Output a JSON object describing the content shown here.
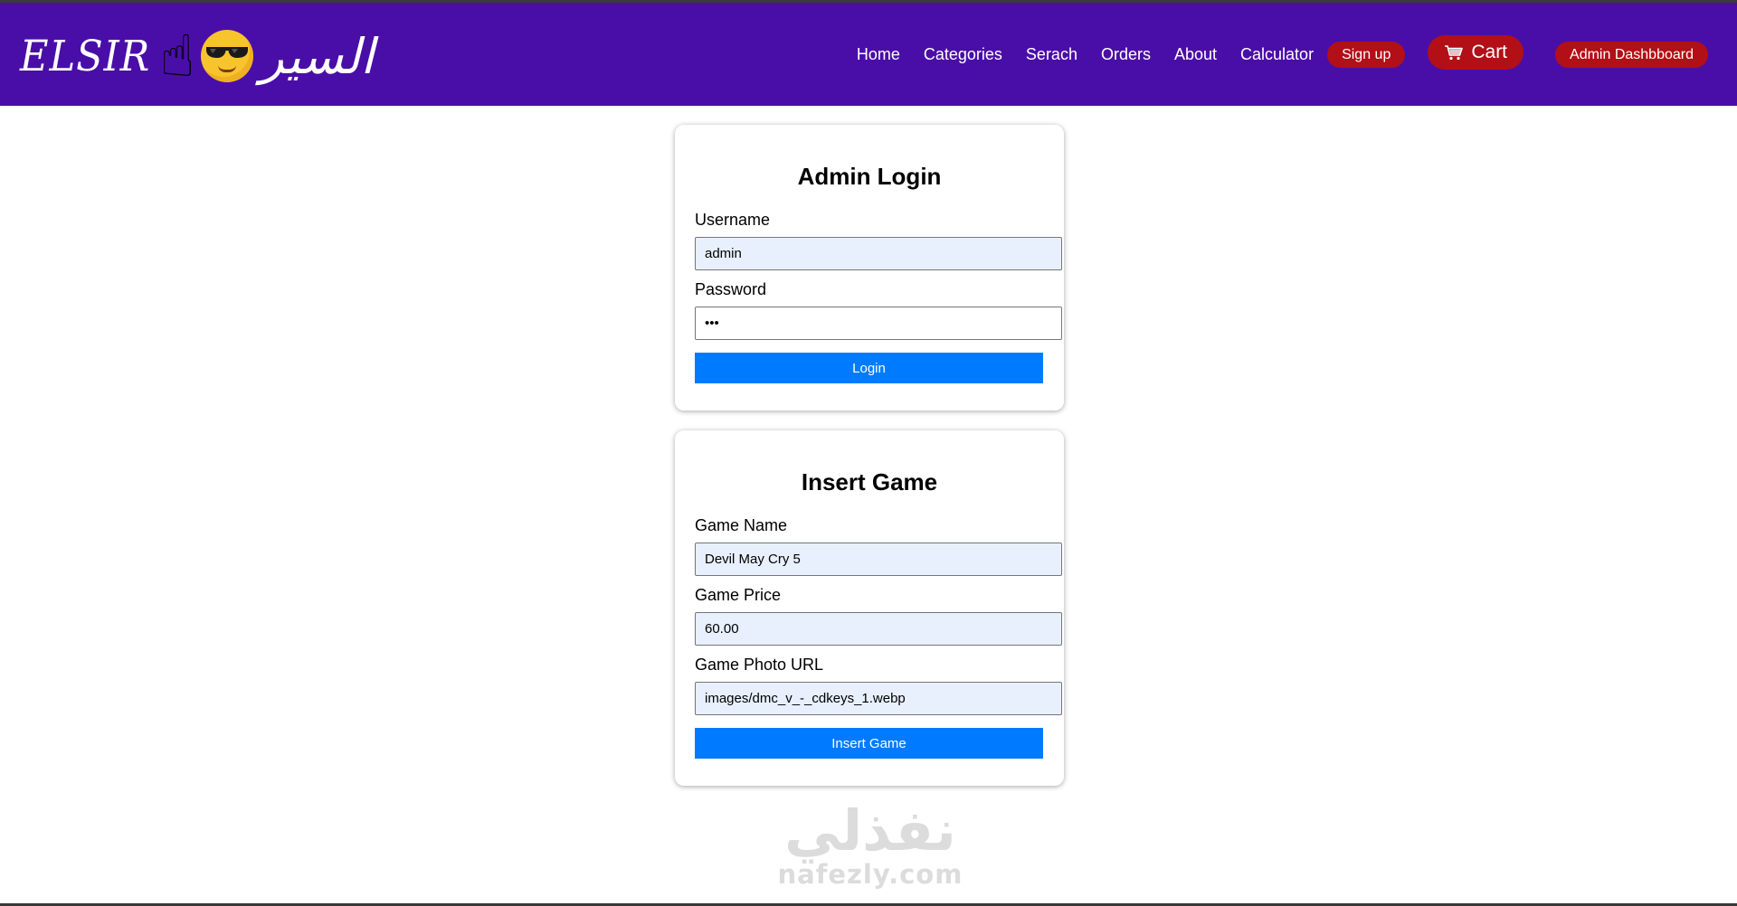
{
  "brand": {
    "latin": "ELSIR",
    "arabic": "السير",
    "pointer_emoji": "☝",
    "face_icon": "sunglasses-face-icon"
  },
  "nav": {
    "home": "Home",
    "categories": "Categories",
    "search": "Serach",
    "orders": "Orders",
    "about": "About",
    "calculator": "Calculator",
    "signup": "Sign up",
    "cart": "Cart",
    "admin_dashboard": "Admin Dashbboard"
  },
  "login": {
    "title": "Admin Login",
    "username_label": "Username",
    "username_value": "admin",
    "password_label": "Password",
    "password_value": "abc",
    "button": "Login"
  },
  "insert_game": {
    "title": "Insert Game",
    "name_label": "Game Name",
    "name_value": "Devil May Cry 5",
    "price_label": "Game Price",
    "price_value": "60.00",
    "photo_label": "Game Photo URL",
    "photo_value": "images/dmc_v_-_cdkeys_1.webp",
    "button": "Insert Game"
  },
  "watermark": {
    "arabic": "نفذلي",
    "latin": "nafezly.com"
  },
  "colors": {
    "header": "#4a0ea8",
    "pill": "#b30f16",
    "button": "#007bff",
    "autofill": "#e8f0fe"
  }
}
